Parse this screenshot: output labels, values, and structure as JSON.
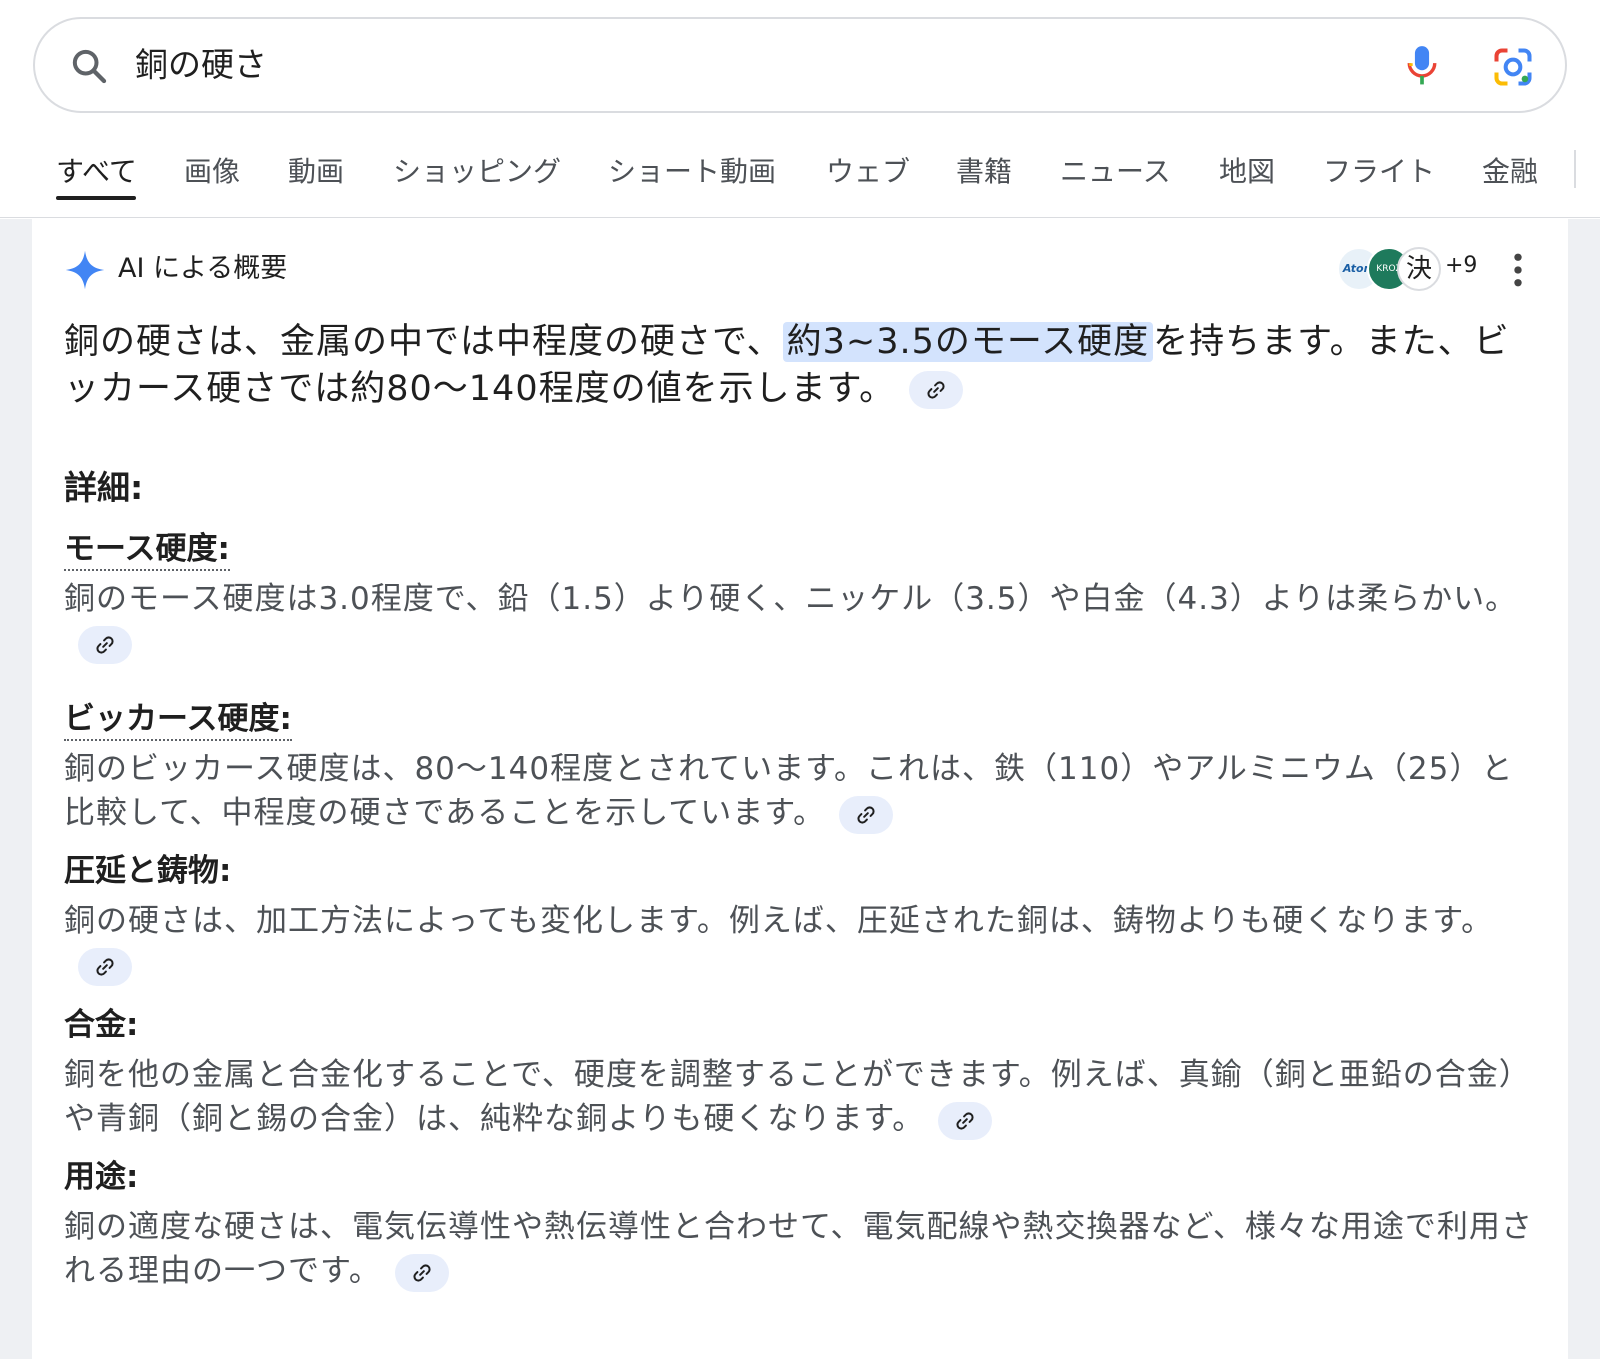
{
  "search": {
    "query": "銅の硬さ"
  },
  "tabs": [
    {
      "label": "すべて",
      "active": true
    },
    {
      "label": "画像"
    },
    {
      "label": "動画"
    },
    {
      "label": "ショッピング"
    },
    {
      "label": "ショート動画"
    },
    {
      "label": "ウェブ"
    },
    {
      "label": "書籍"
    },
    {
      "label": "ニュース"
    },
    {
      "label": "地図"
    },
    {
      "label": "フライト"
    },
    {
      "label": "金融"
    }
  ],
  "ai_overview": {
    "title": "AI による概要",
    "sources": {
      "atom_label": "Atom",
      "green_label": "KROZ",
      "kanji_label": "決",
      "more_count": "+9"
    },
    "summary_before": "銅の硬さは、金属の中では中程度の硬さで、",
    "summary_highlight": "約3~3.5のモース硬度",
    "summary_after": "を持ちます。また、ビッカース硬さでは約80〜140程度の値を示します。",
    "details_title": "詳細:",
    "items": [
      {
        "title": "モース硬度:",
        "body": "銅のモース硬度は3.0程度で、鉛（1.5）より硬く、ニッケル（3.5）や白金（4.3）よりは柔らかい。"
      },
      {
        "title": "ビッカース硬度:",
        "body": "銅のビッカース硬度は、80〜140程度とされています。これは、鉄（110）やアルミニウム（25）と比較して、中程度の硬さであることを示しています。"
      },
      {
        "title": "圧延と鋳物:",
        "body": "銅の硬さは、加工方法によっても変化します。例えば、圧延された銅は、鋳物よりも硬くなります。"
      },
      {
        "title": "合金:",
        "body": "銅を他の金属と合金化することで、硬度を調整することができます。例えば、真鍮（銅と亜鉛の合金）や青銅（銅と錫の合金）は、純粋な銅よりも硬くなります。"
      },
      {
        "title": "用途:",
        "body": "銅の適度な硬さは、電気伝導性や熱伝導性と合わせて、電気配線や熱交換器など、様々な用途で利用される理由の一つです。"
      }
    ]
  },
  "colors": {
    "highlight": "#d3e3fd",
    "link_chip": "#e8eefb",
    "panel_bg": "#eef0f3",
    "sparkle": "#4285f4"
  }
}
